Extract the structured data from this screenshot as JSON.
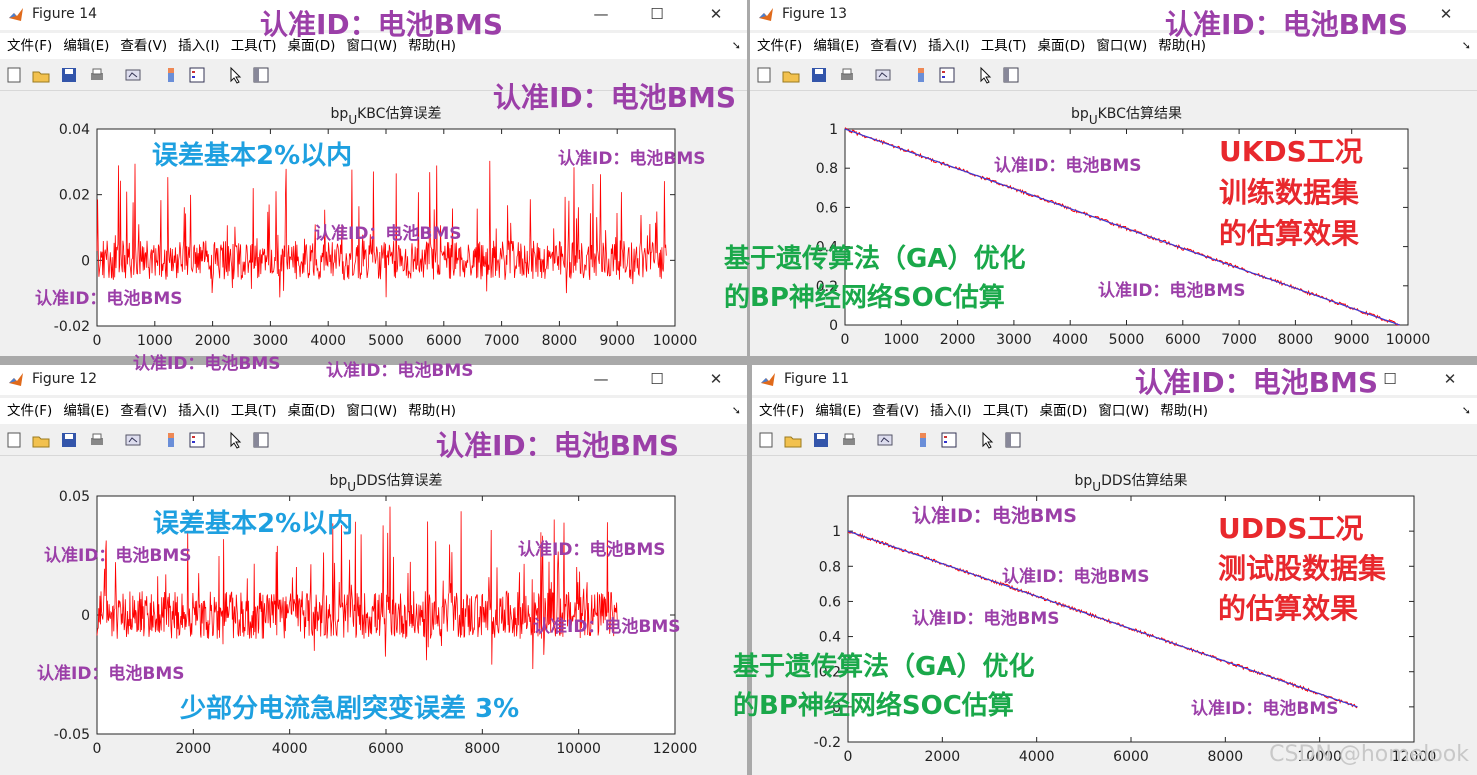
{
  "menu": [
    "文件(F)",
    "编辑(E)",
    "查看(V)",
    "插入(I)",
    "工具(T)",
    "桌面(D)",
    "窗口(W)",
    "帮助(H)"
  ],
  "windows": {
    "fig14": {
      "title": "Figure 14",
      "plot_title": "KBC估算误差"
    },
    "fig13": {
      "title": "Figure 13",
      "plot_title": "KBC估算结果"
    },
    "fig12": {
      "title": "Figure 12",
      "plot_title": "DDS估算误差"
    },
    "fig11": {
      "title": "Figure 11",
      "plot_title": "DDS估算结果"
    }
  },
  "plot_title_prefix": "bp",
  "plot_title_sub": "U",
  "window_buttons": {
    "minimize": "—",
    "maximize": "☐",
    "close": "✕"
  },
  "watermark": "认准ID：电池BMS",
  "annotations": {
    "err_2pct_top": "误差基本2%以内",
    "err_2pct_bottom": "误差基本2%以内",
    "err_3pct": "少部分电流急剧突变误差 3%",
    "ga_top_line1": "基于遗传算法（GA）优化",
    "ga_top_line2": "的BP神经网络SOC估算",
    "ga_bottom_line1": "基于遗传算法（GA）优化",
    "ga_bottom_line2": "的BP神经网络SOC估算",
    "ukds_line1": "UKDS工况",
    "ukds_line2": "训练数据集",
    "ukds_line3": "的估算效果",
    "udds_line1": "UDDS工况",
    "udds_line2": "测试股数据集",
    "udds_line3": "的估算效果"
  },
  "csdn": "CSDN @homelook",
  "colors": {
    "error_line": "#ff0000",
    "estimate_line": "#ff0000",
    "true_line": "#3b3bd6",
    "watermark": "#9b3fa8"
  },
  "chart_data": [
    {
      "type": "line",
      "name": "fig14",
      "title": "KBC估算误差",
      "x_ticks": [
        "0",
        "1000",
        "2000",
        "3000",
        "4000",
        "5000",
        "6000",
        "7000",
        "8000",
        "9000",
        "10000"
      ],
      "y_ticks": [
        "-0.02",
        "0",
        "0.02",
        "0.04"
      ],
      "xlim": [
        0,
        10000
      ],
      "ylim": [
        -0.02,
        0.04
      ],
      "x_end": 9850,
      "grid": false,
      "series": [
        {
          "values_description_stats": {
            "mean": 0.0,
            "max": 0.033,
            "min": -0.016
          }
        }
      ]
    },
    {
      "type": "line",
      "name": "fig13",
      "title": "KBC估算结果",
      "x_ticks": [
        "0",
        "1000",
        "2000",
        "3000",
        "4000",
        "5000",
        "6000",
        "7000",
        "8000",
        "9000",
        "10000"
      ],
      "y_ticks": [
        "0",
        "0.2",
        "0.4",
        "0.6",
        "0.8",
        "1"
      ],
      "xlim": [
        0,
        10000
      ],
      "ylim": [
        0,
        1
      ],
      "x": [
        0,
        9850
      ],
      "y_true": [
        1,
        0
      ],
      "grid": false
    },
    {
      "type": "line",
      "name": "fig12",
      "title": "DDS估算误差",
      "x_ticks": [
        "0",
        "2000",
        "4000",
        "6000",
        "8000",
        "10000",
        "12000"
      ],
      "y_ticks": [
        "-0.05",
        "0",
        "0.05"
      ],
      "xlim": [
        0,
        12000
      ],
      "ylim": [
        -0.05,
        0.05
      ],
      "x_end": 10800,
      "grid": false,
      "series": [
        {
          "values_description_stats": {
            "mean": 0.0,
            "max": 0.041,
            "min": -0.03
          }
        }
      ]
    },
    {
      "type": "line",
      "name": "fig11",
      "title": "DDS估算结果",
      "x_ticks": [
        "0",
        "2000",
        "4000",
        "6000",
        "8000",
        "10000",
        "12000"
      ],
      "y_ticks": [
        "-0.2",
        "0",
        "0.2",
        "0.4",
        "0.6",
        "0.8",
        "1"
      ],
      "xlim": [
        0,
        12000
      ],
      "ylim": [
        -0.2,
        1.2
      ],
      "x": [
        0,
        10800
      ],
      "y_true": [
        1,
        0
      ],
      "grid": false
    }
  ]
}
